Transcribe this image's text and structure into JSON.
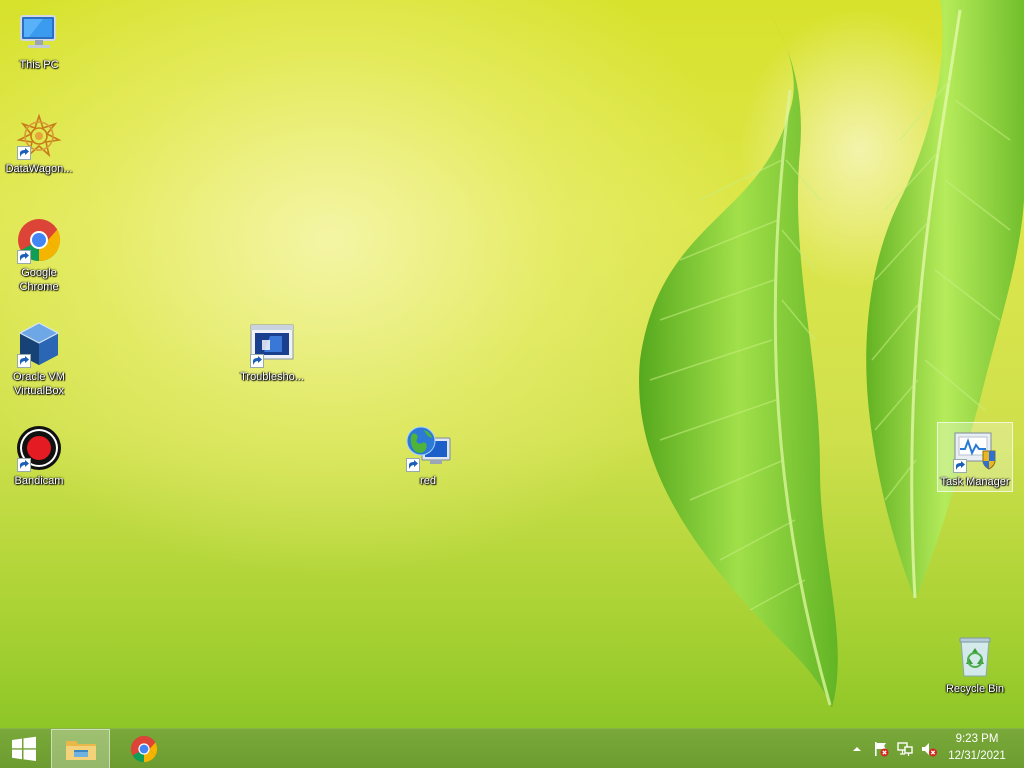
{
  "desktop": {
    "icons": [
      {
        "label": "This PC",
        "icon": "computer-icon",
        "shortcut": false
      },
      {
        "label": "DataWagon...",
        "icon": "datawagon-icon",
        "shortcut": true
      },
      {
        "label": "Google Chrome",
        "icon": "chrome-icon",
        "shortcut": true
      },
      {
        "label": "Oracle VM VirtualBox",
        "icon": "virtualbox-icon",
        "shortcut": true
      },
      {
        "label": "Bandicam",
        "icon": "bandicam-icon",
        "shortcut": true
      },
      {
        "label": "Troublesho...",
        "icon": "troubleshoot-icon",
        "shortcut": true
      },
      {
        "label": "red",
        "icon": "remote-desktop-icon",
        "shortcut": true
      },
      {
        "label": "Task Manager",
        "icon": "task-manager-icon",
        "shortcut": true,
        "selected": true
      },
      {
        "label": "Recycle Bin",
        "icon": "recycle-bin-icon",
        "shortcut": false
      }
    ]
  },
  "taskbar": {
    "pinned": [
      {
        "name": "File Explorer",
        "icon": "file-explorer-icon",
        "active": true
      },
      {
        "name": "Google Chrome",
        "icon": "chrome-icon",
        "active": false
      }
    ],
    "tray": {
      "icons": [
        "show-hidden-icons-icon",
        "action-center-flag-icon",
        "network-icon",
        "volume-muted-icon"
      ]
    },
    "clock": {
      "time": "9:23 PM",
      "date": "12/31/2021"
    }
  },
  "colors": {
    "taskbar": "#6f9f33",
    "wallpaper_light": "#f4f4b0",
    "wallpaper_green": "#8ec627"
  }
}
